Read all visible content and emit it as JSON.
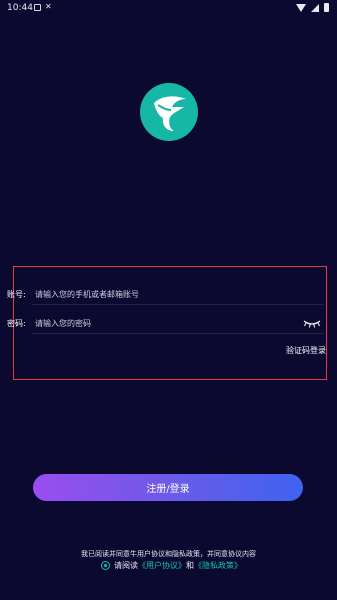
{
  "status_bar": {
    "time": "10:44",
    "notif_x": "✕"
  },
  "login": {
    "account_label": "账号:",
    "account_placeholder": "请输入您的手机或者邮箱账号",
    "password_label": "密码:",
    "password_placeholder": "请输入您的密码",
    "code_login": "验证码登录",
    "submit_label": "注册/登录"
  },
  "agreement": {
    "notice": "我已阅读并同意牛用户协议和隐私政策，并同意协议内容",
    "prefix": "请阅读",
    "user_agreement": "《用户协议》",
    "and": "和",
    "privacy_policy": "《隐私政策》"
  },
  "colors": {
    "background": "#0b0930",
    "accent": "#19c2a7",
    "logo": "#16b7a4",
    "highlight": "#e23a3a"
  },
  "icons": [
    "image-icon",
    "close-icon",
    "wifi-icon",
    "signal-icon",
    "battery-icon",
    "bull-logo-icon",
    "eye-closed-icon",
    "radio-checked-icon"
  ]
}
